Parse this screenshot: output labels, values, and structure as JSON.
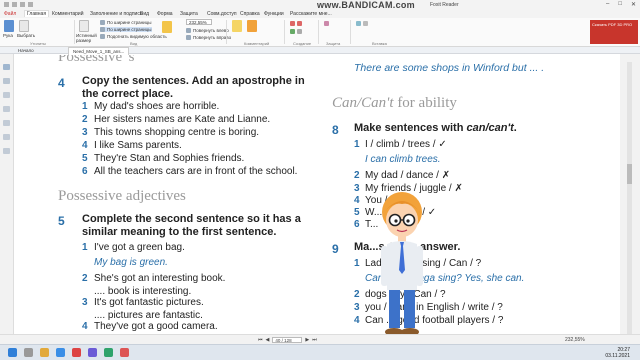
{
  "window": {
    "title": "Foxit Reader",
    "watermark": "www.BANDICAM.com"
  },
  "menu": [
    "Файл",
    "Главная",
    "Комментарий",
    "Заполнение и подпись",
    "Вид",
    "Форма",
    "Защита",
    "Совм.доступ",
    "Справка",
    "Функции",
    "Расскажите мне..."
  ],
  "ribbon": {
    "left_buttons": [
      "Рука",
      "Выбрать"
    ],
    "group_labels": [
      "Утилиты",
      "Вид",
      "Комментарий",
      "Создание",
      "Защита",
      "Вставка"
    ],
    "page_buttons": [
      "Истинный размер",
      "По ширине страницы",
      "Подогнать видимую область"
    ],
    "zoom": "232,55%",
    "rotate": [
      "Повернуть влево",
      "Повернуть вправо"
    ],
    "promo": "Скачать PDF 3D PRO"
  },
  "tabs": {
    "start": "Начало",
    "document": "Need_Move_1_SB_ans..."
  },
  "statusbar": {
    "page": "40 / 128",
    "zoom": "232,55%"
  },
  "taskbar": {
    "time": "20:27",
    "date": "03.11.2021"
  },
  "doc": {
    "left": {
      "top_heading": "Possessive 's",
      "ex4": {
        "num": "4",
        "instr1": "Copy the sentences. Add an apostrophe in",
        "instr2": "the correct place.",
        "items": [
          {
            "n": "1",
            "t": "My dad's shoes are horrible."
          },
          {
            "n": "2",
            "t": "Her sisters names are Kate and Lianne."
          },
          {
            "n": "3",
            "t": "This towns shopping centre is boring."
          },
          {
            "n": "4",
            "t": "I like Sams parents."
          },
          {
            "n": "5",
            "t": "They're Stan and Sophies friends."
          },
          {
            "n": "6",
            "t": "All the teachers cars are in front of the school."
          }
        ]
      },
      "heading2": "Possessive adjectives",
      "ex5": {
        "num": "5",
        "instr1": "Complete the second sentence so it has a",
        "instr2": "similar meaning to the first sentence.",
        "i1": {
          "n": "1",
          "t": "I've got a green bag."
        },
        "a1": "My bag is green.",
        "i2": {
          "n": "2",
          "t": "She's got an interesting book."
        },
        "a2": ".... book is interesting.",
        "i3": {
          "n": "3",
          "t": "It's got fantastic pictures."
        },
        "a3": ".... pictures are fantastic.",
        "i4": {
          "n": "4",
          "t": "They've got a good camera."
        }
      }
    },
    "right": {
      "top_answer": "There are some shops in Winford but ... .",
      "heading": "Can/Can't for ability",
      "heading_eng": "Can/Can't",
      "heading_rest": " for ability",
      "ex8": {
        "num": "8",
        "instr_pre": "Make sentences with ",
        "instr_em": "can/can't",
        "instr_post": ".",
        "i1": {
          "n": "1",
          "t": "I / climb / trees / ✓"
        },
        "a1": "I can climb trees.",
        "i2": {
          "n": "2",
          "t": "My dad / dance / ✗"
        },
        "i3": {
          "n": "3",
          "t": "My friends / juggle / ✗"
        },
        "i4": {
          "n": "4",
          "t": "You / ... / ✓"
        },
        "i5": {
          "n": "5",
          "t": "W...p school / ✓"
        },
        "i6": {
          "n": "6",
          "t": "T..."
        }
      },
      "ex9": {
        "num": "9",
        "instr": "Ma...s. Then answer.",
        "i1": {
          "n": "1",
          "t": "Lady Gaga / sing / Can / ?"
        },
        "a1": "Can Lady Gaga sing? Yes, she can.",
        "i2": {
          "n": "2",
          "t": "dogs / fly / Can / ?"
        },
        "i3": {
          "n": "3",
          "t": "you / Can / in English / write / ?"
        },
        "i4": {
          "n": "4",
          "t": "Can ... good football players / ?"
        }
      }
    }
  }
}
